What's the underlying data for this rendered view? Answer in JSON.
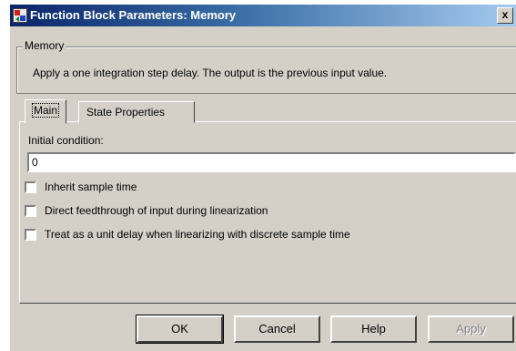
{
  "window": {
    "title": "Function Block Parameters: Memory",
    "close_label": "x"
  },
  "group": {
    "legend": "Memory",
    "description": "Apply a one integration step delay. The output is the previous input value."
  },
  "tabs": [
    {
      "label": "Main",
      "active": true
    },
    {
      "label": "State Properties",
      "active": false
    }
  ],
  "main": {
    "initial_condition_label": "Initial condition:",
    "initial_condition_value": "0",
    "checkboxes": [
      {
        "label": "Inherit sample time",
        "checked": false
      },
      {
        "label": "Direct feedthrough of input during linearization",
        "checked": false
      },
      {
        "label": "Treat as a unit delay when linearizing with discrete sample time",
        "checked": false
      }
    ]
  },
  "buttons": {
    "ok": "OK",
    "cancel": "Cancel",
    "help": "Help",
    "apply": "Apply"
  }
}
